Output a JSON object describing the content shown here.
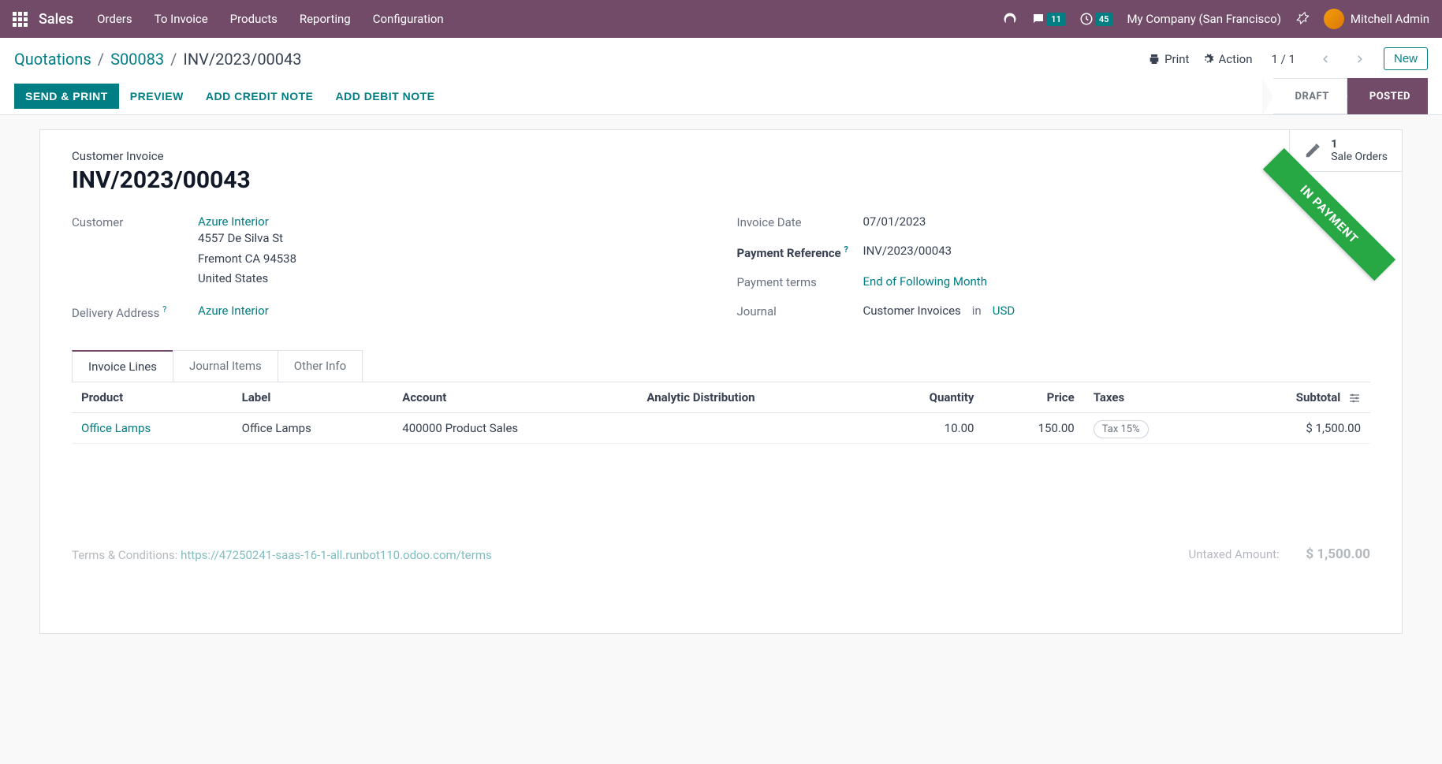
{
  "nav": {
    "app_title": "Sales",
    "items": [
      "Orders",
      "To Invoice",
      "Products",
      "Reporting",
      "Configuration"
    ],
    "msg_count": "11",
    "timer_count": "45",
    "company": "My Company (San Francisco)",
    "user": "Mitchell Admin"
  },
  "breadcrumb": {
    "l1": "Quotations",
    "l2": "S00083",
    "current": "INV/2023/00043"
  },
  "actions": {
    "print": "Print",
    "action": "Action",
    "pager": "1 / 1",
    "new": "New"
  },
  "buttons": {
    "send_print": "SEND & PRINT",
    "preview": "PREVIEW",
    "credit_note": "ADD CREDIT NOTE",
    "debit_note": "ADD DEBIT NOTE"
  },
  "status": {
    "draft": "DRAFT",
    "posted": "POSTED"
  },
  "stat": {
    "count": "1",
    "label": "Sale Orders"
  },
  "ribbon": "IN PAYMENT",
  "form": {
    "subtitle": "Customer Invoice",
    "title": "INV/2023/00043",
    "customer_lbl": "Customer",
    "customer": "Azure Interior",
    "addr1": "4557 De Silva St",
    "addr2": "Fremont CA 94538",
    "addr3": "United States",
    "delivery_lbl": "Delivery Address",
    "delivery": "Azure Interior",
    "inv_date_lbl": "Invoice Date",
    "inv_date": "07/01/2023",
    "payref_lbl": "Payment Reference",
    "payref": "INV/2023/00043",
    "terms_lbl": "Payment terms",
    "terms": "End of Following Month",
    "journal_lbl": "Journal",
    "journal": "Customer Invoices",
    "in": "in",
    "currency": "USD"
  },
  "tabs": {
    "t1": "Invoice Lines",
    "t2": "Journal Items",
    "t3": "Other Info"
  },
  "table": {
    "headers": {
      "product": "Product",
      "label": "Label",
      "account": "Account",
      "analytic": "Analytic Distribution",
      "qty": "Quantity",
      "price": "Price",
      "taxes": "Taxes",
      "subtotal": "Subtotal"
    },
    "rows": [
      {
        "product": "Office Lamps",
        "label": "Office Lamps",
        "account": "400000 Product Sales",
        "analytic": "",
        "qty": "10.00",
        "price": "150.00",
        "tax": "Tax 15%",
        "subtotal": "$ 1,500.00"
      }
    ]
  },
  "footer": {
    "terms_prefix": "Terms & Conditions: ",
    "terms_link": "https://47250241-saas-16-1-all.runbot110.odoo.com/terms",
    "untaxed_lbl": "Untaxed Amount:",
    "untaxed_val": "$ 1,500.00"
  }
}
